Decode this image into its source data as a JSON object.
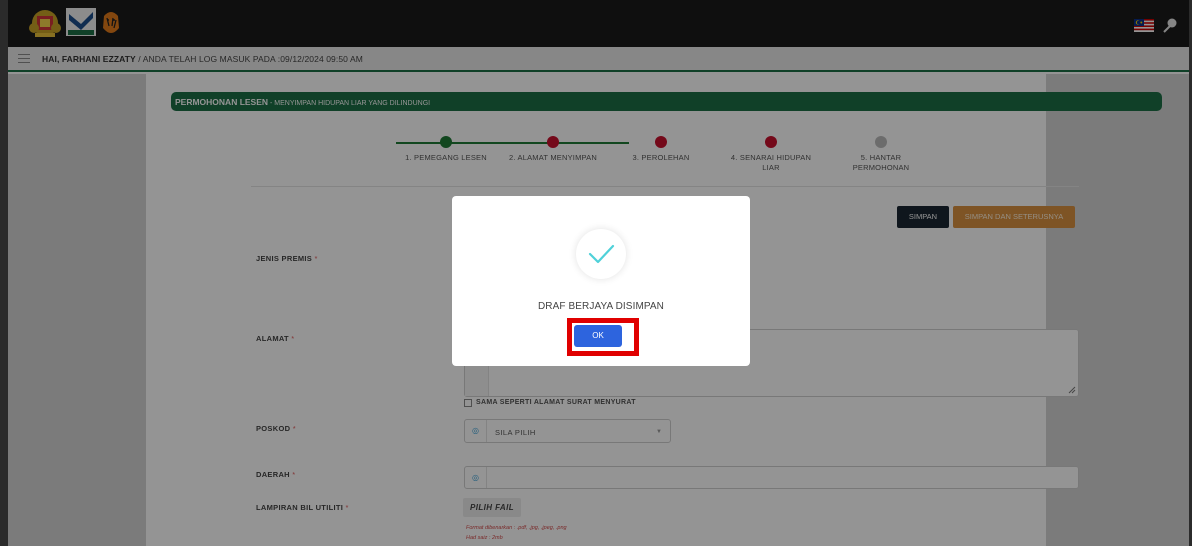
{
  "header": {
    "logos": [
      "jata-negara-logo",
      "perhilitan-logo",
      "tiger-logo"
    ],
    "flag_icon": "malaysia-flag-icon",
    "user_icon": "user-icon"
  },
  "greeting": {
    "name": "HAI, FARHANI EZZATY",
    "login_text": " / ANDA TELAH LOG MASUK PADA :09/12/2024 09:50 AM"
  },
  "page": {
    "title": "PERMOHONAN LESEN",
    "subtitle": " - MENYIMPAN HIDUPAN LIAR YANG DILINDUNGI"
  },
  "stepper": {
    "steps": [
      {
        "label": "1. PEMEGANG LESEN",
        "status": "complete",
        "color": "#1f7a36"
      },
      {
        "label": "2. ALAMAT MENYIMPAN",
        "status": "current",
        "color": "#c8102e"
      },
      {
        "label": "3. PEROLEHAN",
        "status": "pending",
        "color": "#c8102e"
      },
      {
        "label": "4. SENARAI HIDUPAN LIAR",
        "status": "pending",
        "color": "#c8102e"
      },
      {
        "label": "5. HANTAR PERMOHONAN",
        "status": "disabled",
        "color": "#bbbbbb"
      }
    ]
  },
  "actions": {
    "save_label": "SIMPAN",
    "save_next_label": "SIMPAN DAN SETERUSNYA"
  },
  "form": {
    "jenis_premis_label": "JENIS PREMIS",
    "alamat_label": "ALAMAT",
    "same_address_label": "SAMA SEPERTI ALAMAT SURAT MENYURAT",
    "poskod_label": "POSKOD",
    "poskod_value": "SILA PILIH",
    "daerah_label": "DAERAH",
    "daerah_value": "",
    "lampiran_label": "LAMPIRAN BIL UTILITI",
    "pilih_fail_label": "PILIH FAIL",
    "format_note": "Format dibenarkan : .pdf, .jpg, .jpeg, .png",
    "size_note": "Had saiz : 2mb",
    "required_mark": "*"
  },
  "modal": {
    "message": "DRAF BERJAYA DISIMPAN",
    "ok_label": "OK",
    "icon": "success-check-icon"
  },
  "colors": {
    "brand_green": "#1d6e45",
    "save_dark": "#1b2733",
    "save_next_orange": "#d99141",
    "ok_blue": "#2d64de",
    "highlight_red": "#e00000"
  }
}
